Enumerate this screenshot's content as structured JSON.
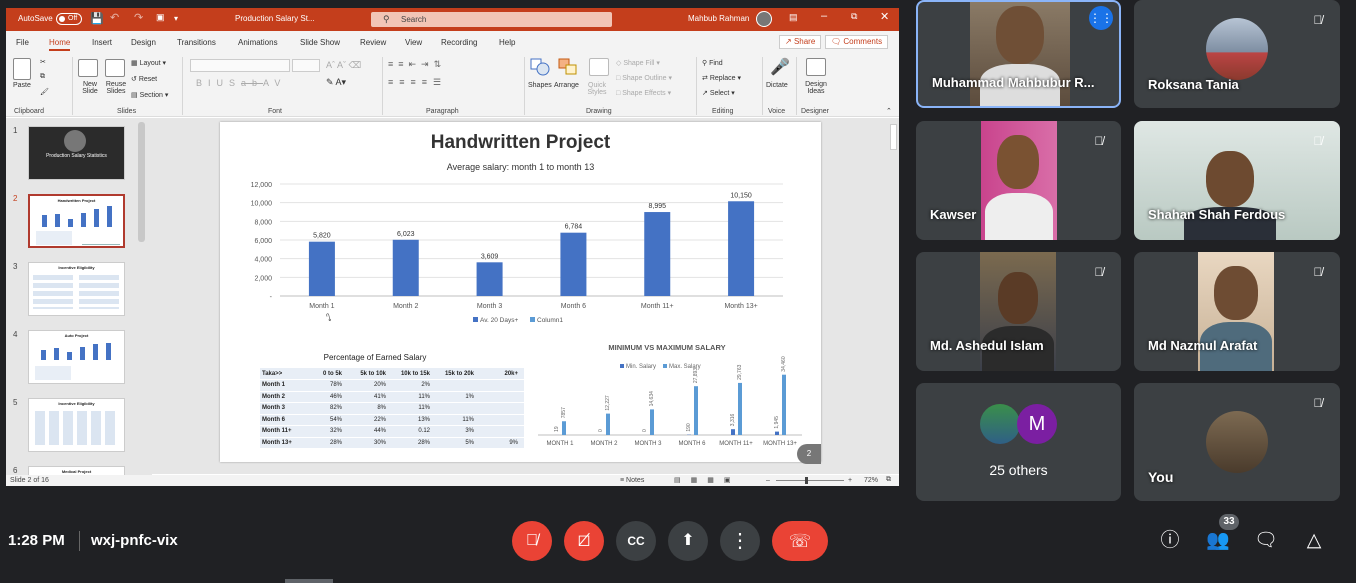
{
  "ppt": {
    "autosave": "AutoSave",
    "autosave_state": "Off",
    "doc_title": "Production Salary St...",
    "search_placeholder": "Search",
    "user_name": "Mahbub Rahman",
    "tabs": [
      "File",
      "Home",
      "Insert",
      "Design",
      "Transitions",
      "Animations",
      "Slide Show",
      "Review",
      "View",
      "Recording",
      "Help"
    ],
    "share_label": "Share",
    "comments_label": "Comments",
    "ribbon": {
      "paste": "Paste",
      "new_slide": "New Slide",
      "reuse_slides": "Reuse Slides",
      "layout": "Layout",
      "reset": "Reset",
      "section": "Section",
      "shapes": "Shapes",
      "arrange": "Arrange",
      "quick_styles": "Quick Styles",
      "shape_fill": "Shape Fill",
      "shape_outline": "Shape Outline",
      "shape_effects": "Shape Effects",
      "find": "Find",
      "replace": "Replace",
      "select": "Select",
      "dictate": "Dictate",
      "design_ideas": "Design Ideas",
      "groups": [
        "Clipboard",
        "Slides",
        "Font",
        "Paragraph",
        "Drawing",
        "Editing",
        "Voice",
        "Designer"
      ]
    },
    "thumbnails": [
      {
        "num": "1",
        "title": "Production Salary Statistics"
      },
      {
        "num": "2",
        "title": "Handwritten Project"
      },
      {
        "num": "3",
        "title": "Incentive Eligibility"
      },
      {
        "num": "4",
        "title": "Auto Project"
      },
      {
        "num": "5",
        "title": "Incentive Eligibility"
      },
      {
        "num": "6",
        "title": "Medical Project"
      }
    ],
    "status": {
      "slide_of": "Slide 2 of 16",
      "notes": "Notes",
      "zoom": "72%",
      "page_badge": "2"
    }
  },
  "slide": {
    "title": "Handwritten Project",
    "subtitle": "Average salary: month 1 to month 13",
    "table_title": "Percentage of Earned Salary",
    "table_header": [
      "Taka>>",
      "0 to 5k",
      "5k to 10k",
      "10k to 15k",
      "15k to 20k",
      "20k+"
    ],
    "table_rows": [
      [
        "Month 1",
        "78%",
        "20%",
        "2%",
        "",
        ""
      ],
      [
        "Month 2",
        "46%",
        "41%",
        "11%",
        "1%",
        ""
      ],
      [
        "Month 3",
        "82%",
        "8%",
        "11%",
        "",
        ""
      ],
      [
        "Month 6",
        "54%",
        "22%",
        "13%",
        "11%",
        ""
      ],
      [
        "Month 11+",
        "32%",
        "44%",
        "0.12",
        "3%",
        ""
      ],
      [
        "Month 13+",
        "28%",
        "30%",
        "28%",
        "5%",
        "9%"
      ]
    ]
  },
  "chart_data": [
    {
      "type": "bar",
      "title": "",
      "categories": [
        "Month 1",
        "Month 2",
        "Month 3",
        "Month 6",
        "Month 11+",
        "Month 13+"
      ],
      "series": [
        {
          "name": "Av. 20 Days+",
          "values": [
            5820,
            6023,
            3609,
            6784,
            8995,
            10150
          ]
        },
        {
          "name": "Column1",
          "values": [
            null,
            null,
            null,
            null,
            null,
            null
          ]
        }
      ],
      "data_labels": [
        "5,820",
        "6,023",
        "3,609",
        "6,784",
        "8,995",
        "10,150"
      ],
      "y_ticks": [
        "12,000",
        "10,000",
        "8,000",
        "6,000",
        "4,000",
        "2,000",
        "-"
      ],
      "ylim": [
        0,
        12000
      ],
      "grid": true,
      "legend": "bottom",
      "color": "#4472c4"
    },
    {
      "type": "bar",
      "title": "MINIMUM VS MAXIMUM SALARY",
      "categories": [
        "MONTH 1",
        "MONTH 2",
        "MONTH 3",
        "MONTH 6",
        "MONTH 11+",
        "MONTH 13+"
      ],
      "series": [
        {
          "name": "Min. Salary",
          "values": [
            19,
            0,
            0,
            190,
            3316,
            1945
          ],
          "labels": [
            "19",
            "0",
            "0",
            "190",
            "3,316",
            "1,945"
          ]
        },
        {
          "name": "Max. Salary",
          "values": [
            7857,
            12227,
            14634,
            27893,
            29763,
            34460
          ],
          "labels": [
            "7857",
            "12,227",
            "14,634",
            "27,893",
            "29,763",
            "34,460"
          ]
        }
      ],
      "ylim": [
        0,
        36000
      ],
      "legend": "top",
      "colors": [
        "#4472c4",
        "#5b9bd5"
      ]
    }
  ],
  "meet": {
    "participants": [
      {
        "name": "Muhammad Mahbubur R...",
        "speaking": true
      },
      {
        "name": "Roksana Tania",
        "muted": true
      },
      {
        "name": "Kawser",
        "muted": true
      },
      {
        "name": "Shahan Shah Ferdous",
        "muted": true
      },
      {
        "name": "Md. Ashedul Islam",
        "muted": true
      },
      {
        "name": "Md Nazmul Arafat",
        "muted": true
      },
      {
        "name": "25 others",
        "avatar_letter": "M"
      },
      {
        "name": "You",
        "muted": true
      }
    ],
    "time": "1:28 PM",
    "meeting_code": "wxj-pnfc-vix",
    "people_count": "33",
    "colors": {
      "accent": "#8ab4f8",
      "danger": "#ea4335",
      "tile": "#3c4043",
      "bg": "#202124"
    }
  }
}
